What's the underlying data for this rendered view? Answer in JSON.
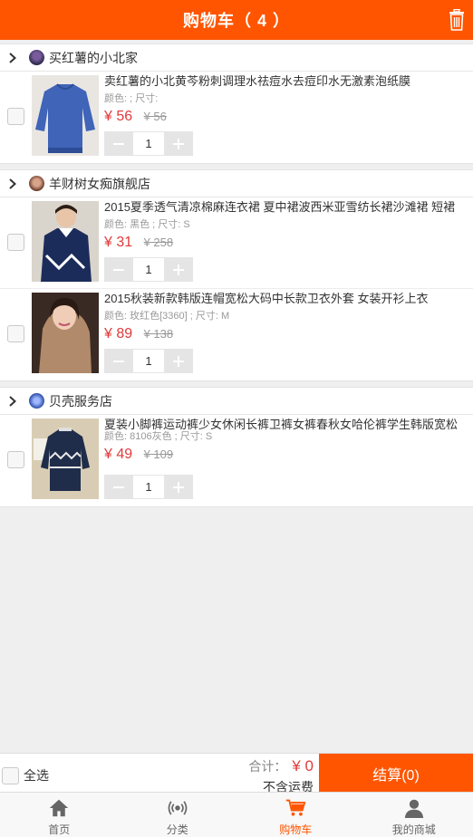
{
  "header": {
    "title": "购物车（ 4 ）",
    "trash_icon": "trash-icon"
  },
  "shops": [
    {
      "name": "买红薯的小北家",
      "items": [
        {
          "title": "卖红薯的小北黄芩粉刺调理水祛痘水去痘印水无激素泡纸膜",
          "spec": "颜色: ; 尺寸:",
          "price": "¥ 56",
          "old_price": "¥ 56",
          "qty": "1",
          "img_color": "#3f64b8"
        }
      ]
    },
    {
      "name": "羊财树女痴旗舰店",
      "items": [
        {
          "title": "2015夏季透气清凉棉麻连衣裙 夏中裙波西米亚雪纺长裙沙滩裙 短裙",
          "spec": "颜色: 黑色 ; 尺寸: S",
          "price": "¥ 31",
          "old_price": "¥ 258",
          "qty": "1",
          "img_color": "#1c2c5a"
        },
        {
          "title": "2015秋装新款韩版连帽宽松大码中长款卫衣外套 女装开衫上衣",
          "spec": "颜色: 玫红色[3360] ; 尺寸: M",
          "price": "¥ 89",
          "old_price": "¥ 138",
          "qty": "1",
          "img_color": "#b08a6a"
        }
      ]
    },
    {
      "name": "贝壳服务店",
      "items": [
        {
          "title": "夏装小脚裤运动裤少女休闲长裤卫裤女裤春秋女哈伦裤学生韩版宽松",
          "spec": "颜色: 8106灰色 ; 尺寸: S",
          "price": "¥ 49",
          "old_price": "¥ 109",
          "qty": "1",
          "img_color": "#1f2d4a"
        }
      ]
    }
  ],
  "footer": {
    "select_all": "全选",
    "total_label": "合计：",
    "total_value": "¥ 0",
    "shipping_note": "不含运费",
    "checkout": "结算(0)"
  },
  "tabs": [
    {
      "label": "首页",
      "icon": "home-icon"
    },
    {
      "label": "分类",
      "icon": "broadcast-icon"
    },
    {
      "label": "购物车",
      "icon": "cart-icon",
      "active": true
    },
    {
      "label": "我的商城",
      "icon": "user-icon"
    }
  ],
  "colors": {
    "accent": "#ff5500",
    "price": "#e23a3a"
  }
}
